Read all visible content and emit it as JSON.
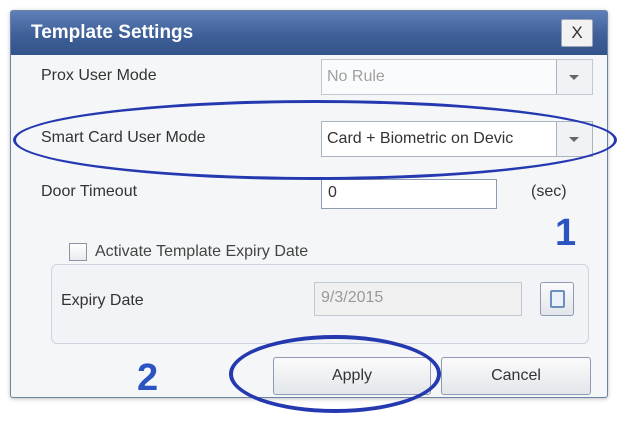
{
  "dialog": {
    "title": "Template Settings",
    "close_label": "X"
  },
  "form": {
    "prox_user_mode": {
      "label": "Prox User Mode",
      "value": "No Rule"
    },
    "smart_card_user_mode": {
      "label": "Smart Card User Mode",
      "value": "Card + Biometric on Devic"
    },
    "door_timeout": {
      "label": "Door Timeout",
      "value": "0",
      "unit": "(sec)"
    },
    "expiry": {
      "checkbox_label": "Activate Template Expiry Date",
      "checked": false,
      "date_label": "Expiry Date",
      "date_value": "9/3/2015"
    }
  },
  "buttons": {
    "apply": "Apply",
    "cancel": "Cancel"
  },
  "annotations": {
    "step_1": "1",
    "step_2": "2",
    "color": "#2438b0"
  },
  "icons": [
    "close-icon",
    "dropdown-arrow-icon",
    "calendar-icon",
    "checkbox-icon"
  ]
}
